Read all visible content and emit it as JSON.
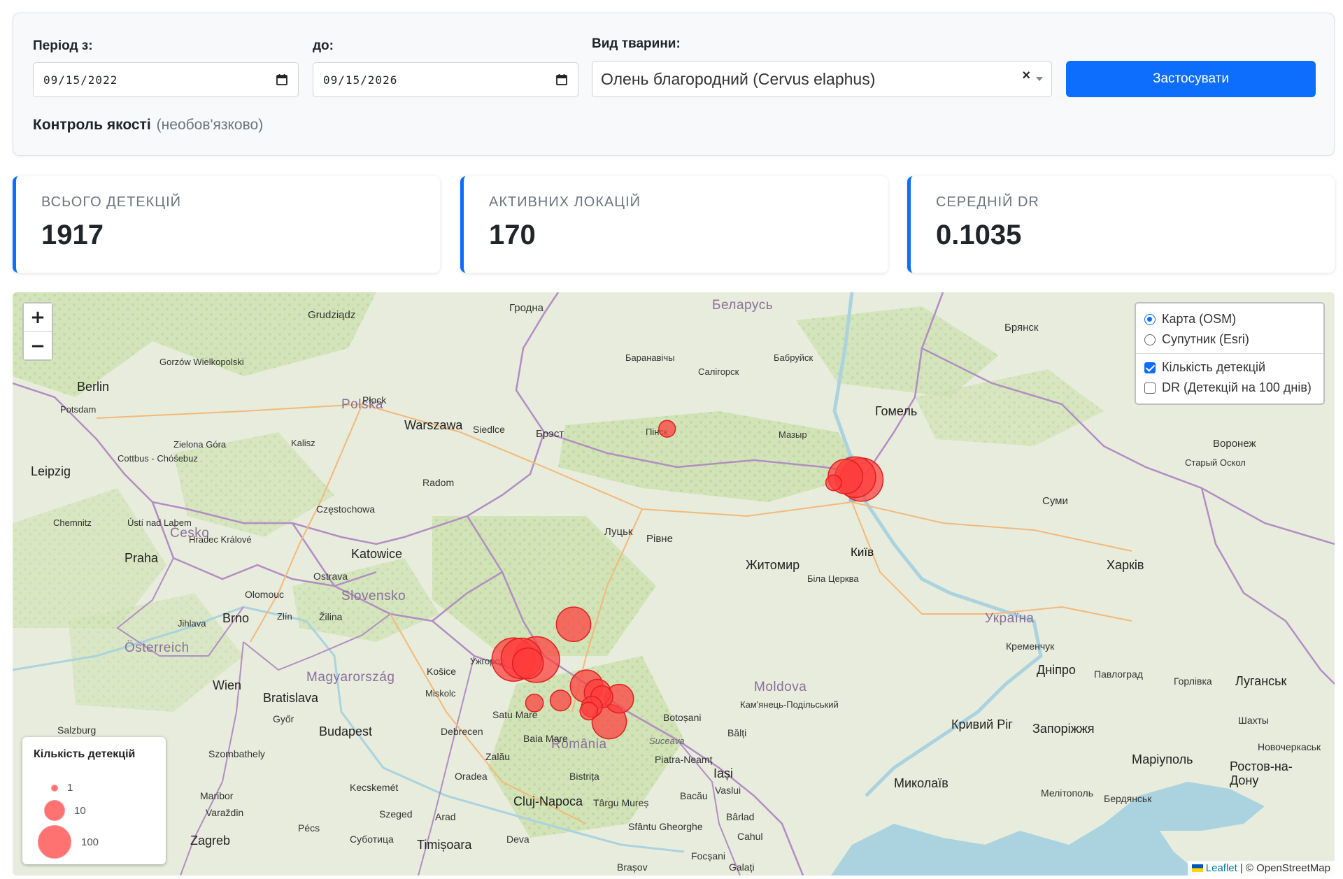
{
  "filters": {
    "period_from_label": "Період з:",
    "period_to_label": "до:",
    "date_from": "09/15/2022",
    "date_to": "09/15/2026",
    "animal_label": "Вид тварини:",
    "animal_value": "Олень благородний (Cervus elaphus)",
    "apply_label": "Застосувати",
    "quality_label": "Контроль якості",
    "quality_optional": "(необов'язково)"
  },
  "stats": [
    {
      "label": "ВСЬОГО ДЕТЕКЦІЙ",
      "value": "1917"
    },
    {
      "label": "АКТИВНИХ ЛОКАЦІЙ",
      "value": "170"
    },
    {
      "label": "СЕРЕДНІЙ DR",
      "value": "0.1035"
    }
  ],
  "map": {
    "zoom_in": "+",
    "zoom_out": "−",
    "layers": {
      "base_osm": "Карта (OSM)",
      "base_esri": "Супутник (Esri)",
      "base_selected": "osm",
      "overlay_count": "Кількість детекцій",
      "overlay_dr": "DR (Детекцій на 100 днів)",
      "overlay_count_checked": true,
      "overlay_dr_checked": false
    },
    "legend": {
      "title": "Кількість детекцій",
      "items": [
        "1",
        "10",
        "100"
      ]
    },
    "attribution": {
      "leaflet": "Leaflet",
      "osm": "| © OpenStreetMap"
    },
    "marker_color": "#ff3b3b",
    "countries": [
      "Polska",
      "Česko",
      "Slovensko",
      "Österreich",
      "Magyarország",
      "România",
      "Moldova",
      "Україна",
      "Беларусь"
    ],
    "cities": [
      "Гродна",
      "Беларусь",
      "Брянск",
      "Grudziądz",
      "Gorzów Wielkopolski",
      "Berlin",
      "Potsdam",
      "Płock",
      "Polska",
      "Warszawa",
      "Siedlce",
      "Брэст",
      "Пінск",
      "Барaнавічы",
      "Салігорск",
      "Бабруйск",
      "Мазыр",
      "Гомель",
      "Воронеж",
      "Старый Оскол",
      "Суми",
      "Київ",
      "Житомир",
      "Біла Церква",
      "Харків",
      "Рівне",
      "Луцьк",
      "Leipzig",
      "Zielona Góra",
      "Cottbus - Chóśebuz",
      "Kalisz",
      "Radom",
      "Częstochowa",
      "Katowice",
      "Chemnitz",
      "Ústí nad Labem",
      "Hradec Králové",
      "Praha",
      "Česko",
      "Ostrava",
      "Olomouc",
      "Brno",
      "Zlín",
      "Jihlava",
      "Žilina",
      "Slovensko",
      "Košice",
      "Ужгород",
      "Wien",
      "Bratislava",
      "Miskolc",
      "Győr",
      "Budapest",
      "Debrecen",
      "Satu Mare",
      "Baia Mare",
      "Zalău",
      "Botoșani",
      "Bălți",
      "Suceava",
      "Piatra-Neamț",
      "Iași",
      "Bacău",
      "Vaslui",
      "Bistrița",
      "Cluj-Napoca",
      "Târgu Mureș",
      "Sfântu Gheorghe",
      "România",
      "Deva",
      "Arad",
      "Szeged",
      "Oradea",
      "Kecskemét",
      "Pécs",
      "Magyarország",
      "Szombathely",
      "Österreich",
      "Salzburg",
      "Maribor",
      "Varaždin",
      "Zagreb",
      "Timișoara",
      "Суботица",
      "Brașov",
      "Focșani",
      "Galați",
      "Cahul",
      "Bârlad",
      "Moldova",
      "Кам'янець-Подільський",
      "Кременчук",
      "Дніпро",
      "Павлоград",
      "Горлівка",
      "Луганськ",
      "Україна",
      "Кривий Ріг",
      "Запоріжжя",
      "Маріуполь",
      "Миколаїв",
      "Мелітополь",
      "Бердянськ",
      "Ростов-на-Дону",
      "Новочеркаськ",
      "Шахты"
    ],
    "detections": [
      {
        "lat": 52.1,
        "lon": 26.05,
        "count": 5
      },
      {
        "lat": 51.23,
        "lon": 29.88,
        "count": 4
      },
      {
        "lat": 51.33,
        "lon": 30.15,
        "count": 40
      },
      {
        "lat": 51.32,
        "lon": 30.38,
        "count": 60
      },
      {
        "lat": 51.28,
        "lon": 30.52,
        "count": 70
      },
      {
        "lat": 48.95,
        "lon": 23.9,
        "count": 40
      },
      {
        "lat": 48.38,
        "lon": 22.52,
        "count": 70
      },
      {
        "lat": 48.4,
        "lon": 22.7,
        "count": 60
      },
      {
        "lat": 48.38,
        "lon": 23.05,
        "count": 80
      },
      {
        "lat": 48.32,
        "lon": 22.85,
        "count": 30
      },
      {
        "lat": 47.95,
        "lon": 24.2,
        "count": 35
      },
      {
        "lat": 47.85,
        "lon": 24.45,
        "count": 20
      },
      {
        "lat": 47.78,
        "lon": 24.55,
        "count": 12
      },
      {
        "lat": 47.75,
        "lon": 24.95,
        "count": 25
      },
      {
        "lat": 47.72,
        "lon": 23.6,
        "count": 10
      },
      {
        "lat": 47.68,
        "lon": 23.0,
        "count": 6
      },
      {
        "lat": 47.62,
        "lon": 24.32,
        "count": 10
      },
      {
        "lat": 47.55,
        "lon": 24.25,
        "count": 6
      },
      {
        "lat": 47.38,
        "lon": 24.72,
        "count": 40
      }
    ]
  }
}
